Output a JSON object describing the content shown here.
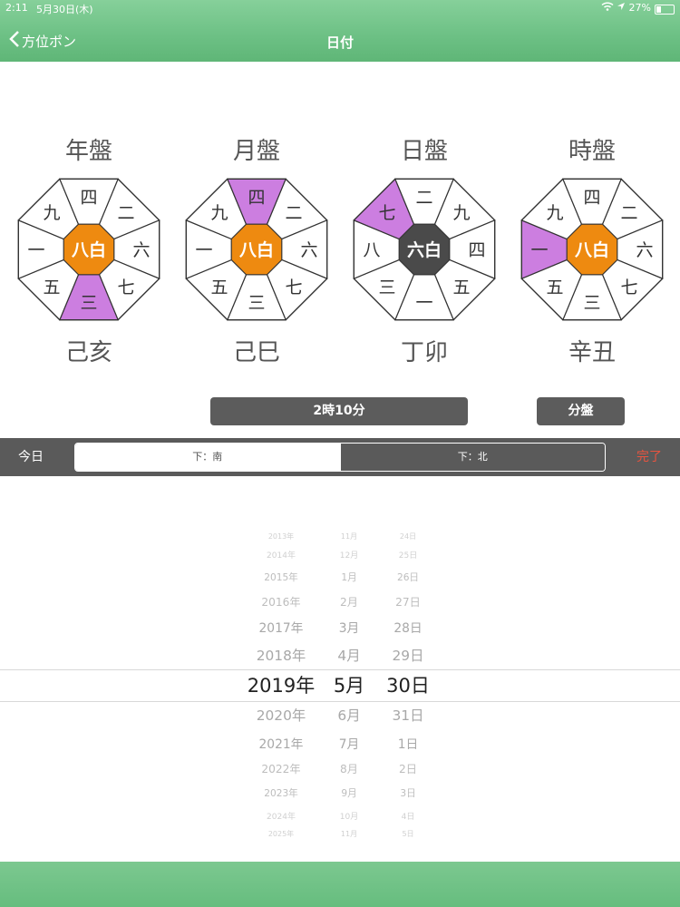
{
  "status_bar": {
    "time": "2:11",
    "date": "5月30日(木)",
    "battery": "27%"
  },
  "nav": {
    "back_label": "方位ポン",
    "title": "日付"
  },
  "colors": {
    "center_orange": "#ee8a10",
    "center_dark": "#4a4a4a",
    "highlight_purple": "#cc7ee0",
    "header_green": "#6cc084",
    "done_red": "#e8543f"
  },
  "charts": [
    {
      "title": "年盤",
      "center": "八白",
      "center_style": "orange",
      "cells": [
        "四",
        "二",
        "六",
        "七",
        "三",
        "五",
        "一",
        "九"
      ],
      "highlight": [
        3
      ],
      "footer": "己亥"
    },
    {
      "title": "月盤",
      "center": "八白",
      "center_style": "orange",
      "cells": [
        "四",
        "二",
        "六",
        "七",
        "三",
        "五",
        "一",
        "九"
      ],
      "highlight": [
        7
      ],
      "footer": "己巳"
    },
    {
      "title": "日盤",
      "center": "六白",
      "center_style": "dark",
      "cells": [
        "二",
        "九",
        "四",
        "五",
        "一",
        "三",
        "八",
        "七"
      ],
      "highlight": [
        6
      ],
      "footer": "丁卯"
    },
    {
      "title": "時盤",
      "center": "八白",
      "center_style": "orange",
      "cells": [
        "四",
        "二",
        "六",
        "七",
        "三",
        "五",
        "一",
        "九"
      ],
      "highlight": [
        5
      ],
      "footer": "辛丑"
    }
  ],
  "buttons": {
    "time": "2時10分",
    "minute_chart": "分盤"
  },
  "toolbar": {
    "today": "今日",
    "seg_south": "下：南",
    "seg_north": "下：北",
    "done": "完了"
  },
  "picker": {
    "rows": [
      {
        "year": "2013年",
        "month": "11月",
        "day": "24日"
      },
      {
        "year": "2014年",
        "month": "12月",
        "day": "25日"
      },
      {
        "year": "2015年",
        "month": "1月",
        "day": "26日"
      },
      {
        "year": "2016年",
        "month": "2月",
        "day": "27日"
      },
      {
        "year": "2017年",
        "month": "3月",
        "day": "28日"
      },
      {
        "year": "2018年",
        "month": "4月",
        "day": "29日"
      },
      {
        "year": "2019年",
        "month": "5月",
        "day": "30日"
      },
      {
        "year": "2020年",
        "month": "6月",
        "day": "31日"
      },
      {
        "year": "2021年",
        "month": "7月",
        "day": "1日"
      },
      {
        "year": "2022年",
        "month": "8月",
        "day": "2日"
      },
      {
        "year": "2023年",
        "month": "9月",
        "day": "3日"
      },
      {
        "year": "2024年",
        "month": "10月",
        "day": "4日"
      },
      {
        "year": "2025年",
        "month": "11月",
        "day": "5日"
      }
    ],
    "selected_index": 6
  }
}
